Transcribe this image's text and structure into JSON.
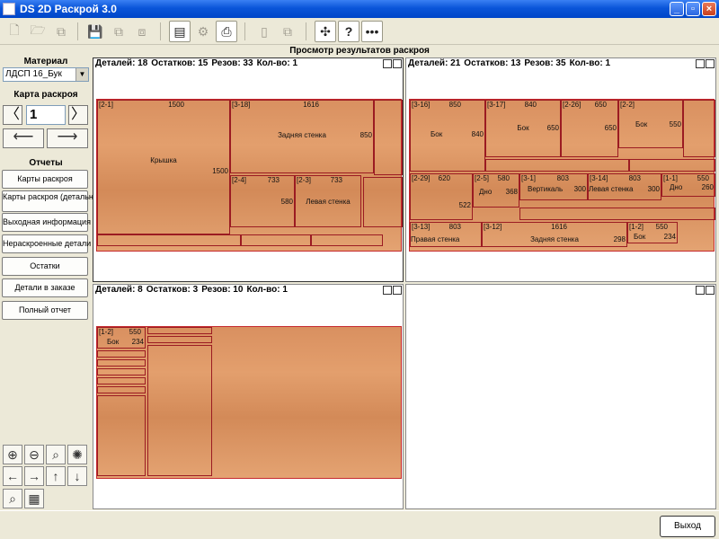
{
  "window": {
    "title": "DS 2D Раскрой 3.0"
  },
  "header": {
    "title": "Просмотр результатов раскроя"
  },
  "left": {
    "material_label": "Материал",
    "material_value": "ЛДСП 16_Бук",
    "map_label": "Карта раскроя",
    "map_number": "1",
    "reports_label": "Отчеты",
    "reports": [
      "Карты раскроя",
      "Карты раскроя (детально)",
      "Выходная информация",
      "Нераскроенные детали",
      "Остатки",
      "Детали в заказе",
      "Полный отчет"
    ]
  },
  "panes": [
    {
      "details": "Деталей: 18",
      "remnants": "Остатков: 15",
      "cuts": "Резов: 33",
      "qty": "Кол-во: 1",
      "parts": [
        {
          "num": "[2-1]",
          "w": "1500",
          "title": "Крышка",
          "h": "1500"
        },
        {
          "num": "[3-18]",
          "w": "1616",
          "title": "Задняя стенка",
          "h": "850"
        },
        {
          "num": "[2-4]",
          "w": "733",
          "title": "",
          "h": "580"
        },
        {
          "num": "[2-3]",
          "w": "733",
          "title": "Левая стенка",
          "h": "580"
        }
      ]
    },
    {
      "details": "Деталей: 21",
      "remnants": "Остатков: 13",
      "cuts": "Резов: 35",
      "qty": "Кол-во: 1",
      "parts": [
        {
          "num": "[3-16]",
          "w": "850",
          "title": "Бок",
          "h": "840"
        },
        {
          "num": "[3-17]",
          "w": "840",
          "title": "Бок",
          "h": "650"
        },
        {
          "num": "[2-26]",
          "w": "650",
          "title": "",
          "h": "650"
        },
        {
          "num": "[2-2]",
          "w": "550",
          "title": "Бок",
          "h": "550"
        },
        {
          "num": "[2-29]",
          "w": "620",
          "title": "",
          "h": "522"
        },
        {
          "num": "[2-5]",
          "w": "580",
          "title": "Дно",
          "h": "368"
        },
        {
          "num": "[3-1]",
          "w": "803",
          "title": "Вертикаль",
          "h": "300"
        },
        {
          "num": "[3-14]",
          "w": "803",
          "title": "Левая стенка",
          "h": "300"
        },
        {
          "num": "[1-1]",
          "w": "550",
          "title": "Дно",
          "h": "260"
        },
        {
          "num": "[3-13]",
          "w": "803",
          "title": "Правая стенка",
          "h": "300"
        },
        {
          "num": "[3-12]",
          "w": "1616",
          "title": "Задняя стенка",
          "h": "298"
        },
        {
          "num": "[1-2]",
          "w": "550",
          "title": "Бок",
          "h": "234"
        }
      ]
    },
    {
      "details": "Деталей: 8",
      "remnants": "Остатков: 3",
      "cuts": "Резов: 10",
      "qty": "Кол-во: 1",
      "parts": [
        {
          "num": "[1-2]",
          "w": "550",
          "title": "Бок",
          "h": "234"
        }
      ]
    }
  ],
  "footer": {
    "exit_label": "Выход"
  }
}
